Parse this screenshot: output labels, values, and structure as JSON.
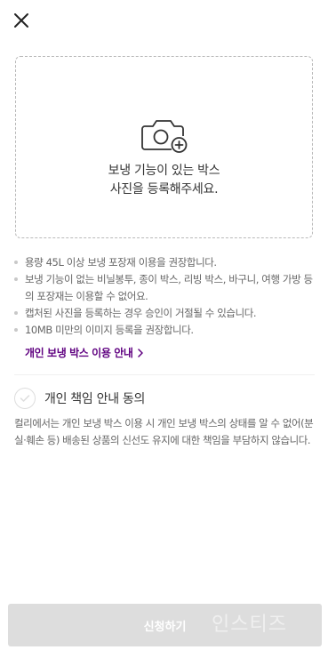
{
  "header": {
    "close_icon": "close-icon"
  },
  "upload": {
    "icon": "camera-plus-icon",
    "line1": "보냉 기능이 있는 박스",
    "line2": "사진을 등록해주세요."
  },
  "notes": [
    "용량 45L 이상 보냉 포장재 이용을 권장합니다.",
    "보냉 기능이 없는 비닐봉투, 종이 박스, 리빙 박스, 바구니, 여행 가방 등의 포장재는 이용할 수 없어요.",
    "캡처된 사진을 등록하는 경우 승인이 거절될 수 있습니다.",
    "10MB 미만의 이미지 등록을 권장합니다."
  ],
  "guide_link": {
    "label": "개인 보냉 박스 이용 안내",
    "color": "#5f0080"
  },
  "agreement": {
    "label": "개인 책임 안내 동의",
    "checked": false,
    "description": "컬리에서는 개인 보냉 박스 이용 시 개인 보냉 박스의 상태를 알 수 없어(분실·훼손 등) 배송된 상품의 신선도 유지에 대한 책임을 부담하지 않습니다."
  },
  "footer": {
    "submit_label": "신청하기",
    "submit_enabled": false,
    "watermark": "인스티즈"
  }
}
